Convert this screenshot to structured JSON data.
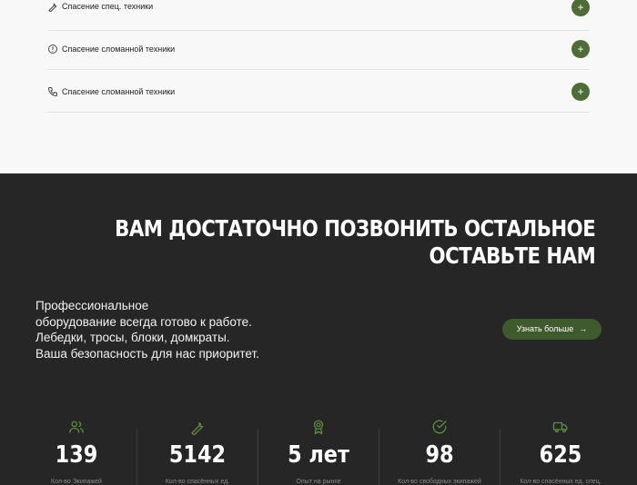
{
  "faq": {
    "items": [
      {
        "label": "Спасение спец. техники",
        "icon": "wrench-icon"
      },
      {
        "label": "Спасение сломанной техники",
        "icon": "alert-circle-icon"
      },
      {
        "label": "Спасение сломанной техники",
        "icon": "phone-icon"
      }
    ],
    "plus": "+"
  },
  "hero": {
    "headline_line1": "ВАМ ДОСТАТОЧНО ПОЗВОНИТЬ ОСТАЛЬНОЕ",
    "headline_line2": "ОСТАВЬТЕ НАМ",
    "intro": [
      "Профессиональное",
      "оборудование всегда готово к работе.",
      "Лебедки, тросы, блоки, домкраты.",
      "Ваша безопасность для нас приоритет."
    ],
    "cta_label": "Узнать больше",
    "cta_arrow": "→"
  },
  "stats": [
    {
      "value": "139",
      "caption": "Кол-во Экипажей",
      "icon": "users-icon"
    },
    {
      "value": "5142",
      "caption": "Кол-во спасённых ед.",
      "icon": "wrench-icon"
    },
    {
      "value": "5 лет",
      "caption": "Опыт на рынке",
      "icon": "award-icon"
    },
    {
      "value": "98",
      "caption": "Кол-во свободных экипажей",
      "icon": "check-circle-icon"
    },
    {
      "value": "625",
      "caption": "Кол-во спасённых ед. спец.",
      "icon": "truck-icon"
    }
  ],
  "colors": {
    "accent": "#4e6c35",
    "cta": "#3f5a2c",
    "dark_bg": "#262626",
    "light_bg": "#f8f8f8",
    "icon_green": "#5b8b3e"
  }
}
